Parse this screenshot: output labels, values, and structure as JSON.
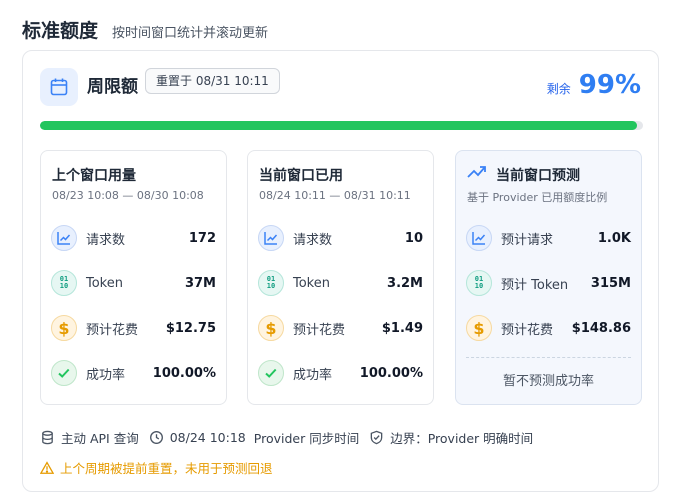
{
  "header": {
    "title": "标准额度",
    "subtitle": "按时间窗口统计并滚动更新"
  },
  "week": {
    "title": "周限额",
    "reset_label": "重置于 08/31 10:11",
    "remaining_label": "剩余",
    "remaining_pct": "99%",
    "remaining_fraction": 0.99,
    "icon": "calendar-icon"
  },
  "cards": [
    {
      "title": "上个窗口用量",
      "range": "08/23 10:08 — 08/30 10:08",
      "rows": [
        {
          "label": "请求数",
          "value": "172"
        },
        {
          "label": "Token",
          "value": "37M"
        },
        {
          "label": "预计花费",
          "value": "$12.75"
        },
        {
          "label": "成功率",
          "value": "100.00%"
        }
      ]
    },
    {
      "title": "当前窗口已用",
      "range": "08/24 10:11 — 08/31 10:11",
      "rows": [
        {
          "label": "请求数",
          "value": "10"
        },
        {
          "label": "Token",
          "value": "3.2M"
        },
        {
          "label": "预计花费",
          "value": "$1.49"
        },
        {
          "label": "成功率",
          "value": "100.00%"
        }
      ]
    },
    {
      "title": "当前窗口预测",
      "range": "基于 Provider 已用额度比例",
      "rows": [
        {
          "label": "预计请求",
          "value": "1.0K"
        },
        {
          "label": "预计 Token",
          "value": "315M"
        },
        {
          "label": "预计花费",
          "value": "$148.86"
        }
      ],
      "no_prediction": "暂不预测成功率"
    }
  ],
  "icons": {
    "token_glyph": "01\n10",
    "cost_glyph": "$"
  },
  "footer": {
    "source": "主动 API 查询",
    "time": "08/24 10:18",
    "time_source": "Provider 同步时间",
    "boundary": "边界：Provider 明确时间",
    "warning": "上个周期被提前重置，未用于预测回退"
  },
  "colors": {
    "accent": "#2f7ef2",
    "progress": "#22c55e",
    "warning": "#e69b00"
  }
}
